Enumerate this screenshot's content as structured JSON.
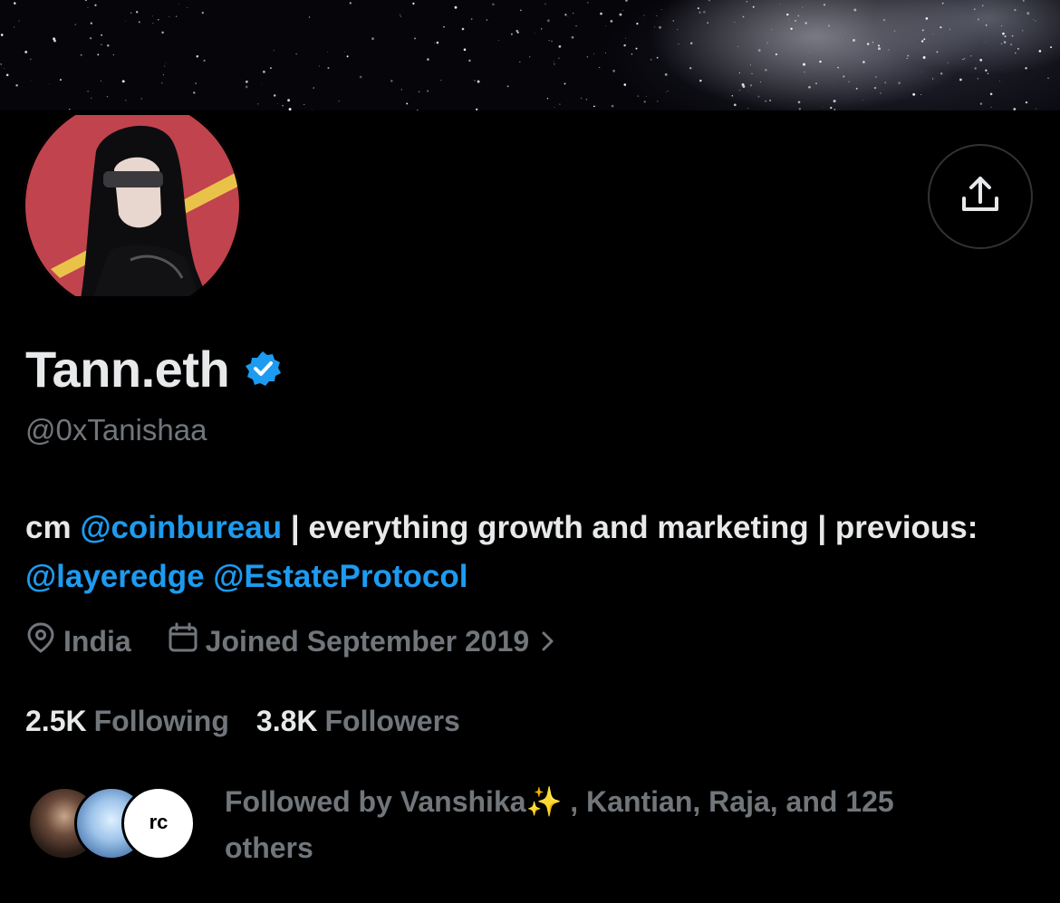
{
  "profile": {
    "display_name": "Tann.eth",
    "handle": "@0xTanishaa",
    "verified_icon": "verified-badge-icon",
    "share_icon": "share-icon"
  },
  "bio": {
    "prefix": "cm ",
    "mention1": "@coinbureau",
    "middle": " | everything growth and marketing | previous: ",
    "mention2": "@layeredge",
    "space": " ",
    "mention3": "@EstateProtocol"
  },
  "meta": {
    "location_icon": "location-pin-icon",
    "location": "India",
    "joined_icon": "calendar-icon",
    "joined": "Joined September 2019",
    "chevron_icon": "chevron-right-icon"
  },
  "stats": {
    "following_count": "2.5K",
    "following_label": "Following",
    "followers_count": "3.8K",
    "followers_label": "Followers"
  },
  "followed_by": {
    "text": "Followed by Vanshika✨ , Kantian, Raja, and 125 others"
  },
  "colors": {
    "accent": "#1d9bf0",
    "muted": "#71767b",
    "text": "#e7e9ea",
    "background": "#000000",
    "avatar_bg": "#c0434d"
  }
}
